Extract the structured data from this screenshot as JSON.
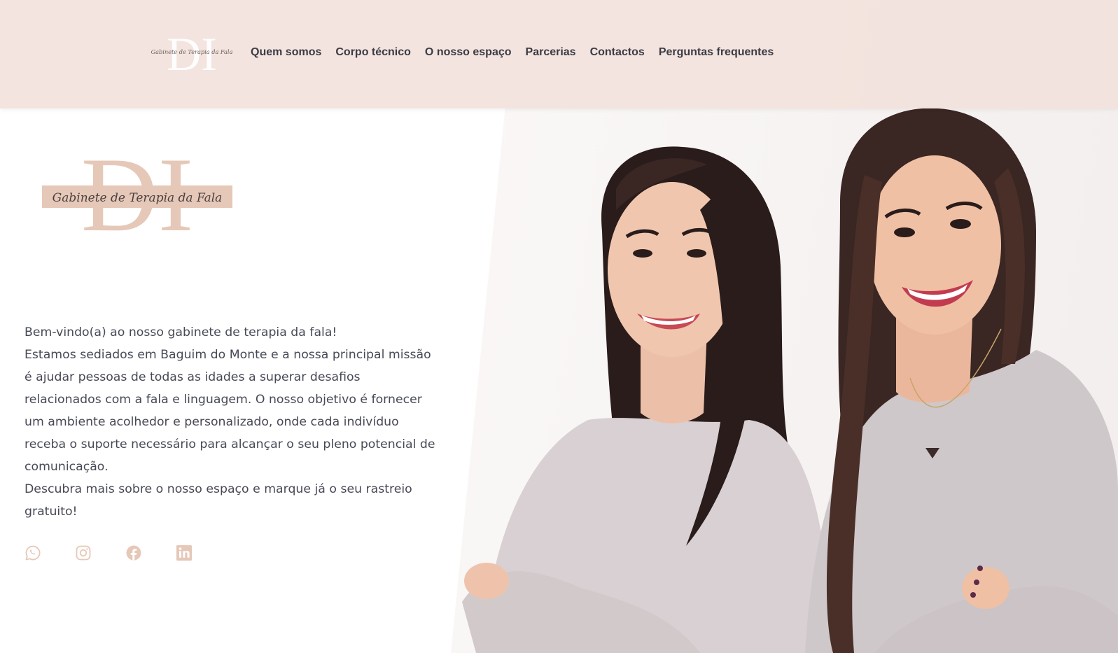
{
  "brand": {
    "logo_text": "Gabinete de Terapia da Fala",
    "monogram": "DI"
  },
  "nav": {
    "items": [
      {
        "label": "Quem somos"
      },
      {
        "label": "Corpo técnico"
      },
      {
        "label": "O nosso espaço"
      },
      {
        "label": "Parcerias"
      },
      {
        "label": "Contactos"
      },
      {
        "label": "Perguntas frequentes"
      }
    ]
  },
  "intro": {
    "greeting": "Bem-vindo(a) ao nosso gabinete de terapia da fala!",
    "mission": "Estamos sediados em Baguim do Monte e a nossa principal missão é ajudar pessoas de todas as idades a superar desafios relacionados com a fala e linguagem. O nosso objetivo é fornecer um ambiente acolhedor e personalizado, onde cada indivíduo receba o suporte necessário para alcançar o seu pleno potencial de comunicação.",
    "cta": "Descubra mais sobre o nosso espaço e marque já o seu rastreio gratuito!"
  },
  "social": {
    "icons": [
      "whatsapp-icon",
      "instagram-icon",
      "facebook-icon",
      "linkedin-icon"
    ]
  },
  "colors": {
    "header_bg": "#f2e2dd",
    "accent": "#e6c8b8",
    "nav_text": "#3b3b45",
    "body_text": "#474a56"
  }
}
